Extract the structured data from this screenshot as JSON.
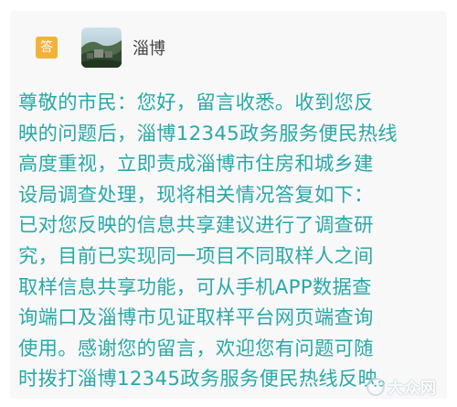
{
  "header": {
    "badge_label": "答",
    "account_name": "淄博"
  },
  "reply": {
    "text": "尊敬的市民：您好，留言收悉。收到您反\n映的问题后，淄博12345政务服务便民热线\n高度重视，立即责成淄博市住房和城乡建\n设局调查处理，现将相关情况答复如下：\n已对您反映的信息共享建议进行了调查研\n究，目前已实现同一项目不同取样人之间\n取样信息共享功能，可从手机APP数据查\n询端口及淄博市见证取样平台网页端查询\n使用。感谢您的留言，欢迎您有问题可随\n时拨打淄博12345政务服务便民热线反映。"
  },
  "watermark": {
    "text": "大众网",
    "logo_icon": "dazhong-logo-icon"
  },
  "colors": {
    "reply_text": "#2aa8a8",
    "badge": "#f2b23a",
    "card_background": "#f8f8f8"
  }
}
